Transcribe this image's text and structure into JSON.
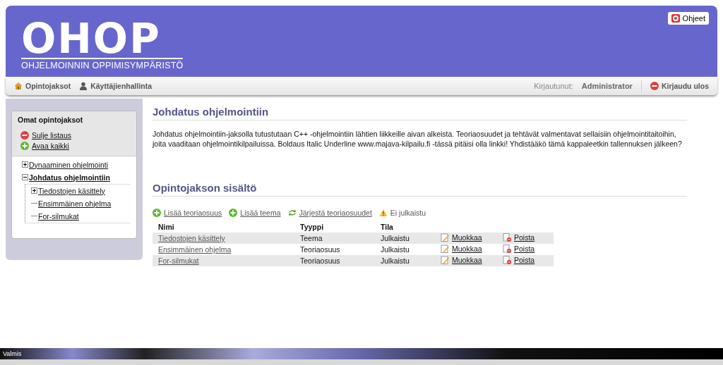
{
  "header": {
    "logo": "OHOP",
    "subtitle": "OHJELMOINNIN OPPIMISYMPÄRISTÖ",
    "help_button": "Ohjeet"
  },
  "nav": {
    "items": [
      "Opintojaksot",
      "Käyttäjienhallinta"
    ],
    "logged_in_label": "Kirjautunut:",
    "user": "Administrator",
    "logout": "Kirjaudu ulos"
  },
  "sidebar": {
    "title": "Omat opintojaksot",
    "actions": [
      {
        "kind": "close",
        "label": "Sulje listaus"
      },
      {
        "kind": "add",
        "label": "Avaa kaikki"
      }
    ],
    "tree": [
      {
        "label": "Dynaaminen ohjelmointi",
        "expanded": false,
        "selected": false
      },
      {
        "label": "Johdatus ohjelmointiin",
        "expanded": true,
        "selected": true,
        "children": [
          {
            "label": "Tiedostojen käsittely",
            "expanded": false,
            "selected": false
          },
          {
            "label": "Ensimmäinen ohjelma",
            "selected": false
          },
          {
            "label": "For-silmukat",
            "selected": false
          }
        ]
      }
    ]
  },
  "course": {
    "title": "Johdatus ohjelmointiin",
    "description": "Johdatus ohjelmointiin-jaksolla tutustutaan C++ -ohjelmointiin lähtien liikkeille aivan alkeista. Teoriaosuudet ja tehtävät valmentavat sellaisiin ohjelmointitaitoihin, joita vaaditaan ohjelmointikilpailuissa.   Boldaus Italic Underline www.majava-kilpailu.fi -tässä pitäisi olla linkki!   Yhdistääkö tämä kappaleetkin tallennuksen jälkeen?"
  },
  "contents": {
    "title": "Opintojakson sisältö",
    "actions": [
      {
        "kind": "add",
        "label": "Lisää teoriaosuus"
      },
      {
        "kind": "add",
        "label": "Lisää teema"
      },
      {
        "kind": "sort",
        "label": "Järjestä teoriaosuudet"
      },
      {
        "kind": "warning",
        "label": "Ei julkaistu"
      }
    ],
    "table": {
      "columns": [
        "Nimi",
        "Tyyppi",
        "Tila"
      ],
      "rows": [
        {
          "name": "Tiedostojen käsittely",
          "type": "Teema",
          "status": "Julkaistu",
          "edit": "Muokkaa",
          "delete": "Poista"
        },
        {
          "name": "Ensimmäinen ohjelma",
          "type": "Teoriaosuus",
          "status": "Julkaistu",
          "edit": "Muokkaa",
          "delete": "Poista"
        },
        {
          "name": "For-silmukat",
          "type": "Teoriaosuus",
          "status": "Julkaistu",
          "edit": "Muokkaa",
          "delete": "Poista"
        }
      ]
    }
  },
  "status_bar": {
    "text": "Valmis"
  }
}
